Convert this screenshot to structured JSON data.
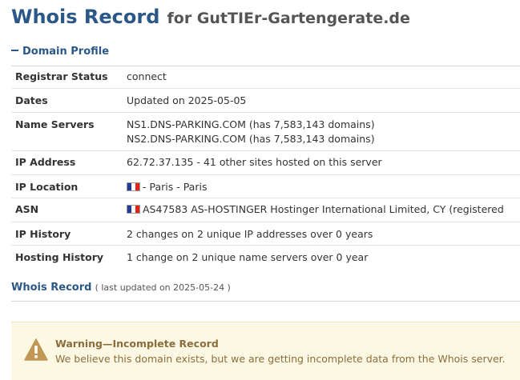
{
  "header": {
    "title": "Whois Record",
    "subtitle": "for GutTIEr-Gartengerate.de"
  },
  "domain_profile": {
    "heading": "Domain Profile",
    "rows": [
      {
        "label": "Registrar Status",
        "value": "connect"
      },
      {
        "label": "Dates",
        "value": "Updated on 2025-05-05"
      },
      {
        "label": "Name Servers",
        "values": [
          "NS1.DNS-PARKING.COM (has 7,583,143 domains)",
          "NS2.DNS-PARKING.COM (has 7,583,143 domains)"
        ]
      },
      {
        "label": "IP Address",
        "value": "62.72.37.135 - 41 other sites hosted on this server"
      },
      {
        "label": "IP Location",
        "value": "- Paris - Paris",
        "flag": "france-flag"
      },
      {
        "label": "ASN",
        "value": "AS47583 AS-HOSTINGER Hostinger International Limited, CY (registered",
        "flag": "france-flag"
      },
      {
        "label": "IP History",
        "value": "2 changes on 2 unique IP addresses over 0 years"
      },
      {
        "label": "Hosting History",
        "value": "1 change on 2 unique name servers over 0 year"
      }
    ]
  },
  "whois_record": {
    "heading": "Whois Record",
    "updated": "( last updated on 2025-05-24 )"
  },
  "warning": {
    "icon": "warning-triangle-icon",
    "title": "Warning—Incomplete Record",
    "message": "We believe this domain exists, but we are getting incomplete data from the Whois server.",
    "colors": {
      "background": "#fcf8e3",
      "text": "#8a6d3b",
      "icon": "#c09853"
    }
  },
  "colors": {
    "accent": "#2b5787"
  }
}
